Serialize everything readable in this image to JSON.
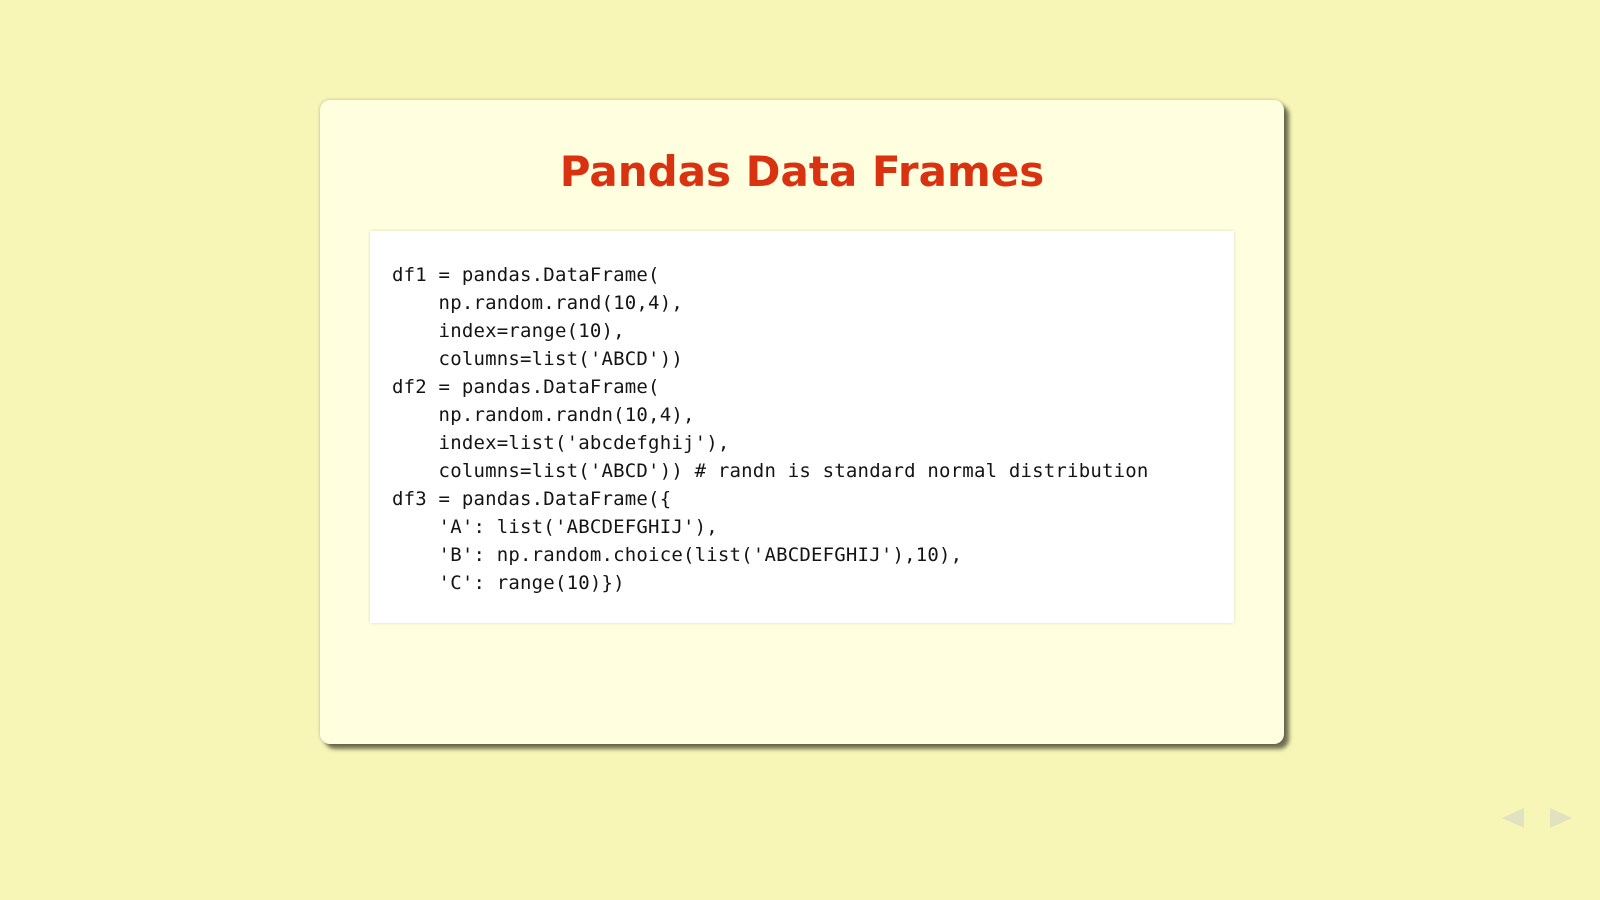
{
  "slide": {
    "title": "Pandas Data Frames",
    "code_lines": [
      "df1 = pandas.DataFrame(",
      "    np.random.rand(10,4),",
      "    index=range(10),",
      "    columns=list('ABCD'))",
      "df2 = pandas.DataFrame(",
      "    np.random.randn(10,4),",
      "    index=list('abcdefghij'),",
      "    columns=list('ABCD')) # randn is standard normal distribution",
      "df3 = pandas.DataFrame({",
      "    'A': list('ABCDEFGHIJ'),",
      "    'B': np.random.choice(list('ABCDEFGHIJ'),10),",
      "    'C': range(10)})"
    ]
  },
  "controls": {
    "prev_icon": "triangle-left-icon",
    "next_icon": "triangle-right-icon"
  },
  "colors": {
    "page_background": "#f7f6b6",
    "slide_background": "#ffffdf",
    "title": "#d93211",
    "code_background": "#ffffff"
  }
}
